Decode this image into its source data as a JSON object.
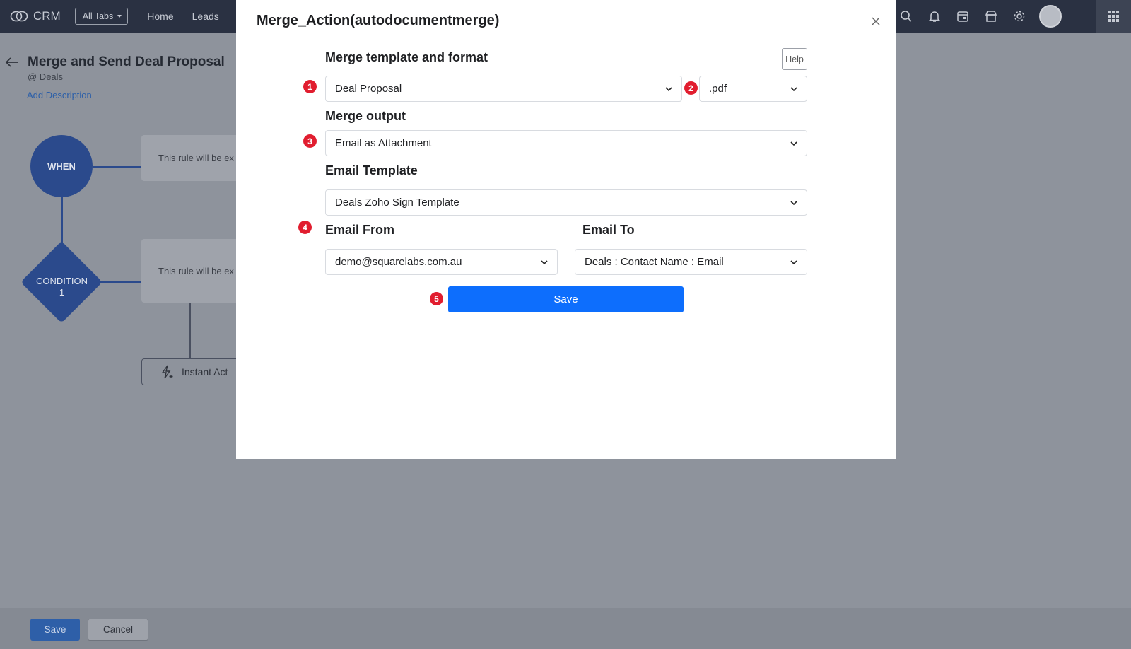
{
  "app": {
    "brand": "CRM",
    "all_tabs_label": "All Tabs",
    "nav": [
      "Home",
      "Leads"
    ]
  },
  "page": {
    "title": "Merge and Send Deal Proposal",
    "module": "@ Deals",
    "add_description": "Add Description"
  },
  "flow": {
    "when_label": "WHEN",
    "condition_label": "CONDITION",
    "condition_number": "1",
    "rule_text_1": "This rule will be ex",
    "rule_text_2": "This rule will be ex",
    "instant_action_label": "Instant Act"
  },
  "footer": {
    "save_label": "Save",
    "cancel_label": "Cancel"
  },
  "modal": {
    "title": "Merge_Action(autodocumentmerge)",
    "help_label": "Help",
    "sections": {
      "template_format": "Merge template and format",
      "output": "Merge output",
      "email_template": "Email Template",
      "email_from": "Email From",
      "email_to": "Email To"
    },
    "fields": {
      "merge_template": "Deal Proposal",
      "format": ".pdf",
      "merge_output": "Email as Attachment",
      "email_template": "Deals Zoho Sign Template",
      "email_from": "demo@squarelabs.com.au",
      "email_to": "Deals : Contact Name : Email"
    },
    "badges": [
      "1",
      "2",
      "3",
      "4",
      "5"
    ],
    "save_label": "Save"
  },
  "colors": {
    "primary": "#0d6efd",
    "badge": "#e11d2f",
    "topbar": "#2a3142",
    "flow": "#2b4a8c"
  }
}
